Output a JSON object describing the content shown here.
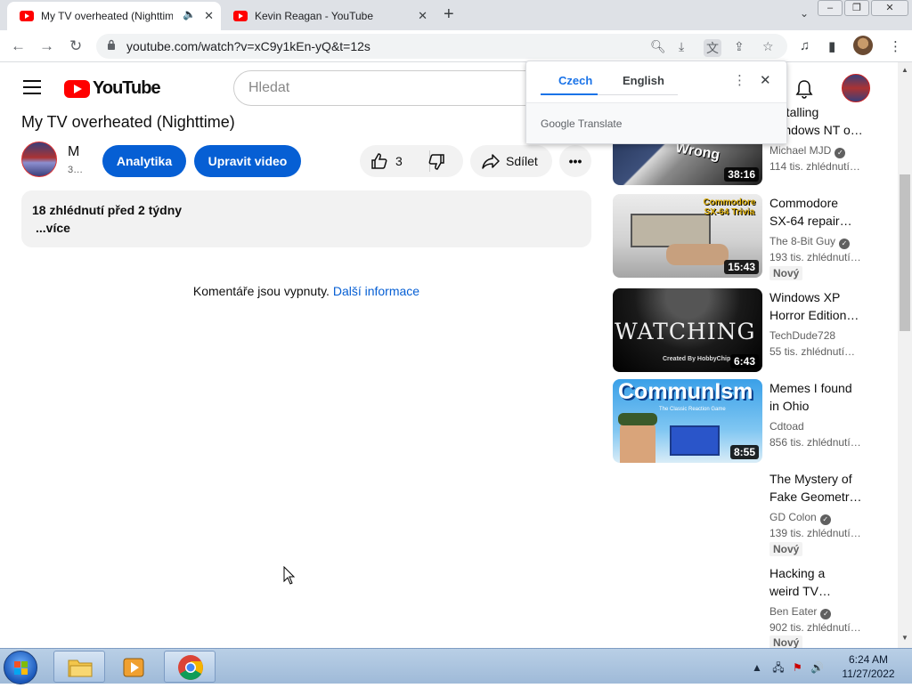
{
  "browser": {
    "tabs": [
      {
        "title": "My TV overheated (Nighttime)",
        "active": true
      },
      {
        "title": "Kevin Reagan - YouTube",
        "active": false
      }
    ],
    "new_tab_symbol": "+",
    "url": "youtube.com/watch?v=xC9y1kEn-yQ&t=12s",
    "icons": [
      "back-icon",
      "forward-icon",
      "reload-icon",
      "lock-icon",
      "search-icon",
      "install-icon",
      "translate-icon",
      "share-icon",
      "star-icon",
      "media-control-icon",
      "side-panel-icon",
      "profile-icon",
      "menu-icon"
    ]
  },
  "youtube": {
    "logo_text": "YouTube",
    "search_placeholder": "Hledat",
    "video": {
      "title": "My TV overheated (Nighttime)",
      "channel_name": "M",
      "channel_subs": "3…",
      "analytics_label": "Analytika",
      "edit_label": "Upravit video",
      "like_count": "3",
      "share_label": "Sdílet",
      "description_meta": "18 zhlédnutí  před 2 týdny",
      "description_more": "...více",
      "comments_off": "Komentáře jsou vypnuty.",
      "comments_link": "Další informace"
    },
    "recommendations": [
      {
        "title_line1": "Installing",
        "title_line2": "Windows NT o…",
        "channel": "Michael MJD",
        "verified": true,
        "views": "114 tis. zhlédnutí…",
        "duration": "38:16",
        "new": false
      },
      {
        "title_line1": "Commodore",
        "title_line2": "SX-64 repair…",
        "channel": "The 8-Bit Guy",
        "verified": true,
        "views": "193 tis. zhlédnutí…",
        "duration": "15:43",
        "new": true,
        "thumb_text": "Commodore SX-64 Trivia"
      },
      {
        "title_line1": "Windows XP",
        "title_line2": "Horror Edition…",
        "channel": "TechDude728",
        "verified": false,
        "views": "55 tis. zhlédnutí…",
        "duration": "6:43",
        "new": false,
        "thumb_text": "WATCHING YOU",
        "thumb_sub": "Created By HobbyChip"
      },
      {
        "title_line1": "Memes I found",
        "title_line2": "in Ohio",
        "channel": "Cdtoad",
        "verified": false,
        "views": "856 tis. zhlédnutí…",
        "duration": "8:55",
        "new": false,
        "thumb_text": "CommunIsm",
        "thumb_sub": "The Classic Reaction Game"
      },
      {
        "title_line1": "The Mystery of",
        "title_line2": "Fake Geometr…",
        "channel": "GD Colon",
        "verified": true,
        "views": "139 tis. zhlédnutí…",
        "new": true
      },
      {
        "title_line1": "Hacking a",
        "title_line2": "weird TV…",
        "channel": "Ben Eater",
        "verified": true,
        "views": "902 tis. zhlédnutí…",
        "new": true
      }
    ],
    "new_badge": "Nový"
  },
  "translate_popup": {
    "source_lang": "Czech",
    "target_lang": "English",
    "brand_google": "Google",
    "brand_translate": "Translate"
  },
  "taskbar": {
    "time": "6:24 AM",
    "date": "11/27/2022",
    "pinned": [
      "file-explorer",
      "media-player",
      "chrome"
    ]
  },
  "colors": {
    "youtube_red": "#ff0000",
    "button_blue": "#065fd4",
    "link_blue": "#065fd4",
    "translate_blue": "#1a73e8"
  }
}
